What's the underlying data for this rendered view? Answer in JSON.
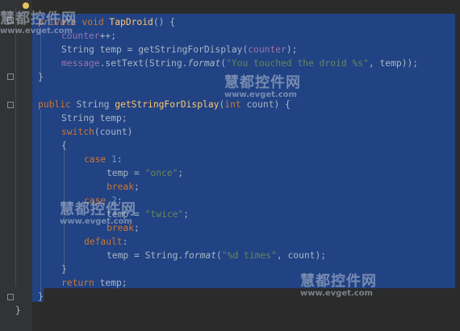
{
  "editor": {
    "lines": [
      {
        "id": "l1",
        "parts": [
          {
            "t": "private void ",
            "c": "kw"
          },
          {
            "t": "TapDroid",
            "c": "fn"
          },
          {
            "t": "() {",
            "c": ""
          }
        ]
      },
      {
        "id": "l2",
        "parts": [
          {
            "t": "counter",
            "c": "fld"
          },
          {
            "t": "++;",
            "c": ""
          }
        ]
      },
      {
        "id": "l3",
        "parts": [
          {
            "t": "String temp = getStringForDisplay(",
            "c": ""
          },
          {
            "t": "counter",
            "c": "fld"
          },
          {
            "t": ");",
            "c": ""
          }
        ]
      },
      {
        "id": "l4",
        "parts": [
          {
            "t": "message",
            "c": "fld"
          },
          {
            "t": ".setText(String.",
            "c": ""
          },
          {
            "t": "format",
            "c": "it"
          },
          {
            "t": "(",
            "c": ""
          },
          {
            "t": "\"You touched the droid %s\"",
            "c": "str"
          },
          {
            "t": ", temp));",
            "c": ""
          }
        ]
      },
      {
        "id": "l5",
        "parts": [
          {
            "t": "}",
            "c": ""
          }
        ]
      },
      {
        "id": "l6",
        "parts": []
      },
      {
        "id": "l7",
        "parts": [
          {
            "t": "public ",
            "c": "kw"
          },
          {
            "t": "String ",
            "c": ""
          },
          {
            "t": "getStringForDisplay",
            "c": "fn"
          },
          {
            "t": "(",
            "c": ""
          },
          {
            "t": "int ",
            "c": "kw"
          },
          {
            "t": "count) {",
            "c": ""
          }
        ]
      },
      {
        "id": "l8",
        "parts": [
          {
            "t": "String temp;",
            "c": ""
          }
        ]
      },
      {
        "id": "l9",
        "parts": [
          {
            "t": "switch",
            "c": "kw"
          },
          {
            "t": "(count)",
            "c": ""
          }
        ]
      },
      {
        "id": "l10",
        "parts": [
          {
            "t": "{",
            "c": ""
          }
        ]
      },
      {
        "id": "l11",
        "parts": [
          {
            "t": "case ",
            "c": "kw"
          },
          {
            "t": "1",
            "c": "num"
          },
          {
            "t": ":",
            "c": ""
          }
        ]
      },
      {
        "id": "l12",
        "parts": [
          {
            "t": "temp = ",
            "c": ""
          },
          {
            "t": "\"once\"",
            "c": "str"
          },
          {
            "t": ";",
            "c": ""
          }
        ]
      },
      {
        "id": "l13",
        "parts": [
          {
            "t": "break",
            "c": "kw"
          },
          {
            "t": ";",
            "c": ""
          }
        ]
      },
      {
        "id": "l14",
        "parts": [
          {
            "t": "case ",
            "c": "kw"
          },
          {
            "t": "2",
            "c": "num"
          },
          {
            "t": ":",
            "c": ""
          }
        ]
      },
      {
        "id": "l15",
        "parts": [
          {
            "t": "temp = ",
            "c": ""
          },
          {
            "t": "\"twice\"",
            "c": "str"
          },
          {
            "t": ";",
            "c": ""
          }
        ]
      },
      {
        "id": "l16",
        "parts": [
          {
            "t": "break",
            "c": "kw"
          },
          {
            "t": ";",
            "c": ""
          }
        ]
      },
      {
        "id": "l17",
        "parts": [
          {
            "t": "default",
            "c": "kw"
          },
          {
            "t": ":",
            "c": ""
          }
        ]
      },
      {
        "id": "l18",
        "parts": [
          {
            "t": "temp = String.",
            "c": ""
          },
          {
            "t": "format",
            "c": "it"
          },
          {
            "t": "(",
            "c": ""
          },
          {
            "t": "\"%d times\"",
            "c": "str"
          },
          {
            "t": ", count);",
            "c": ""
          }
        ]
      },
      {
        "id": "l19",
        "parts": [
          {
            "t": "}",
            "c": ""
          }
        ]
      },
      {
        "id": "l20",
        "parts": [
          {
            "t": "return ",
            "c": "kw"
          },
          {
            "t": "temp;",
            "c": ""
          }
        ]
      },
      {
        "id": "l21",
        "parts": [
          {
            "t": "}",
            "c": ""
          }
        ]
      },
      {
        "id": "l22",
        "parts": [
          {
            "t": "}",
            "c": ""
          }
        ]
      }
    ]
  },
  "watermarks": [
    {
      "title": "慧都控件网",
      "url": "www.evget.com"
    },
    {
      "title": "慧都控件网",
      "url": "www.evget.com"
    },
    {
      "title": "慧都控件网",
      "url": "www.evget.com"
    },
    {
      "title": "慧都控件网",
      "url": "www.evget.com"
    }
  ],
  "colors": {
    "background": "#2b2b2b",
    "selection": "#214283",
    "keyword": "#cc7832",
    "method": "#ffc66d",
    "field": "#9876aa",
    "string": "#6a8759",
    "number": "#6897bb",
    "text": "#a9b7c6"
  }
}
